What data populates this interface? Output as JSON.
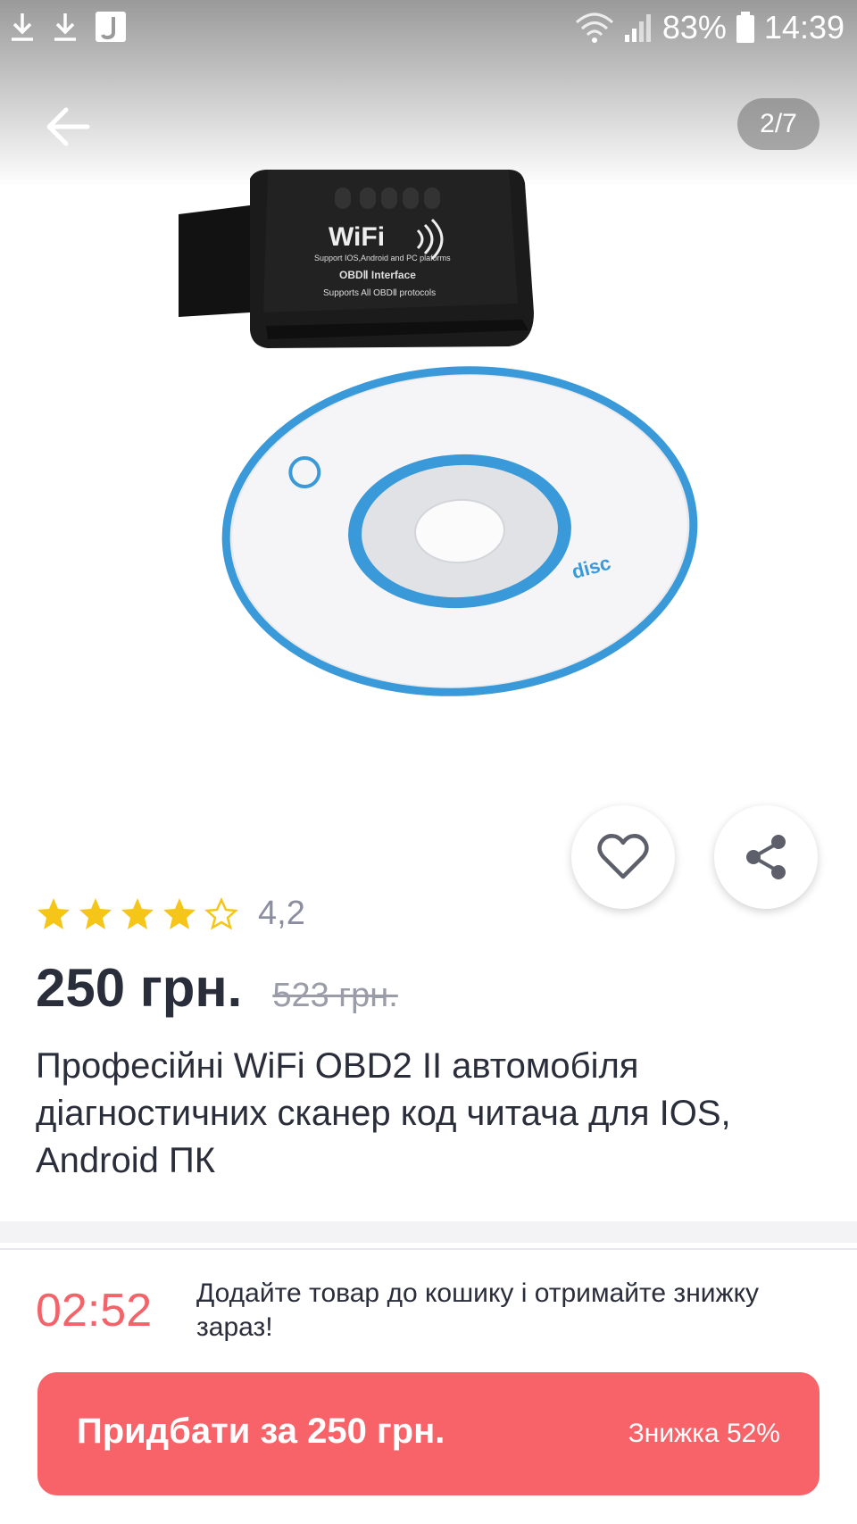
{
  "status_bar": {
    "battery": "83%",
    "time": "14:39"
  },
  "gallery": {
    "pager": "2/7",
    "image_text": {
      "brand": "WiFi",
      "line1": "Support IOS,Android and PC plaforms",
      "line2": "OBDⅡ Interface",
      "line3": "Supports All OBDⅡ protocols",
      "disc_logo": "disc"
    }
  },
  "rating": {
    "value": "4,2",
    "stars": 4.2
  },
  "price": {
    "current": "250 грн.",
    "old": "523 грн."
  },
  "product": {
    "title": "Професійні WiFi OBD2 II автомобіля діагностичних сканер код читача для IOS, Android ПК"
  },
  "promo": {
    "timer": "02:52",
    "message": "Додайте товар до кошику і отримайте знижку зараз!"
  },
  "buy_button": {
    "label": "Придбати за 250 грн.",
    "discount": "Знижка 52%"
  },
  "colors": {
    "accent": "#f76368",
    "star": "#f5c518",
    "text": "#2a2d3a"
  }
}
